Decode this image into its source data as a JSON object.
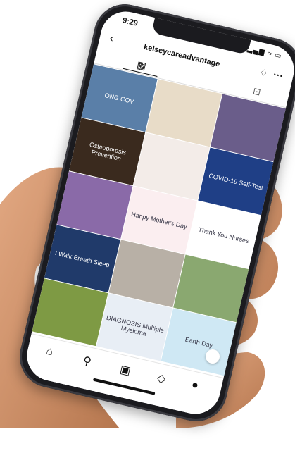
{
  "status": {
    "time": "9:29",
    "icons": "▂▄▆ ≈ ▭"
  },
  "header": {
    "username": "kelseycareadvantage"
  },
  "icons": {
    "back": "‹",
    "bell": "♢",
    "more": "···",
    "grid": "▦",
    "tagged": "⊡"
  },
  "tiles": [
    {
      "text": "ONG COV",
      "bg": "#5a7fa8"
    },
    {
      "text": "",
      "bg": "#e8dcc8"
    },
    {
      "text": "",
      "bg": "#6a5d8a"
    },
    {
      "text": "Osteoporosis Prevention",
      "bg": "#3a2a1e"
    },
    {
      "text": "",
      "bg": "#f3ece8"
    },
    {
      "text": "COVID-19 Self-Test",
      "bg": "#1f3f86"
    },
    {
      "text": "",
      "bg": "#8a6aa8"
    },
    {
      "text": "Happy Mother's Day",
      "bg": "#fbeef0"
    },
    {
      "text": "Thank You Nurses",
      "bg": "#ffffff"
    },
    {
      "text": "I Walk Breath Sleep",
      "bg": "#203a6a"
    },
    {
      "text": "",
      "bg": "#b8b0a6"
    },
    {
      "text": "",
      "bg": "#8aa870"
    },
    {
      "text": "",
      "bg": "#7e9a44"
    },
    {
      "text": "DIAGNOSIS Multiple Myeloma",
      "bg": "#e8eef5"
    },
    {
      "text": "Earth Day",
      "bg": "#cfe8f4"
    }
  ],
  "nav": {
    "home": "⌂",
    "search": "⚲",
    "reels": "▣",
    "shop": "◇",
    "profile": "●"
  },
  "colors": {
    "phone": "#1b1b1f",
    "screen": "#ffffff",
    "skin": "#d79a72"
  }
}
